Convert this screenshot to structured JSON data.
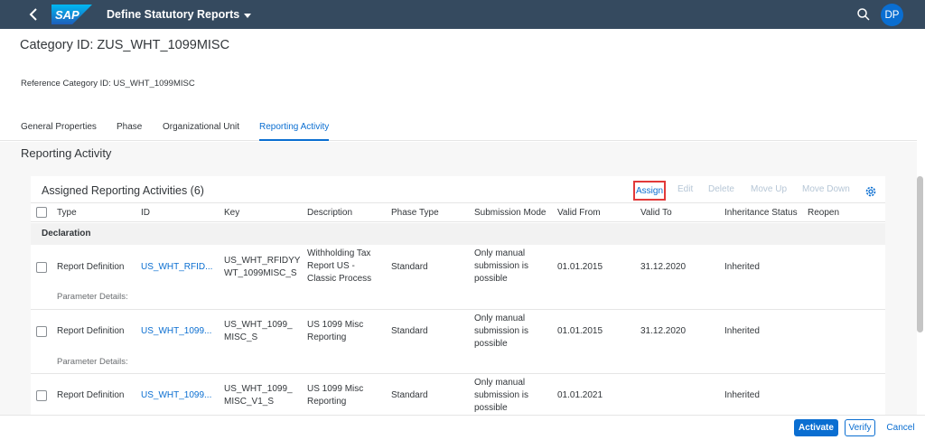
{
  "shell": {
    "app_title": "Define Statutory Reports",
    "logo_text": "SAP",
    "avatar_initials": "DP"
  },
  "header": {
    "object_title": "Category ID: ZUS_WHT_1099MISC",
    "reference_category": "Reference Category ID: US_WHT_1099MISC"
  },
  "tabs": [
    {
      "label": "General Properties"
    },
    {
      "label": "Phase"
    },
    {
      "label": "Organizational Unit"
    },
    {
      "label": "Reporting Activity"
    }
  ],
  "section": {
    "title": "Reporting Activity",
    "table_title": "Assigned Reporting Activities (6)",
    "toolbar": {
      "assign": "Assign",
      "edit": "Edit",
      "delete": "Delete",
      "move_up": "Move Up",
      "move_down": "Move Down"
    },
    "columns": [
      "Type",
      "ID",
      "Key",
      "Description",
      "Phase Type",
      "Submission Mode",
      "Valid From",
      "Valid To",
      "Inheritance Status",
      "Reopen"
    ],
    "group": "Declaration",
    "param_label": "Parameter Details:",
    "rows": [
      {
        "type": "Report Definition",
        "id": "US_WHT_RFID...",
        "key": [
          "US_WHT_RFIDYY",
          "WT_1099MISC_S"
        ],
        "description": [
          "Withholding Tax",
          "Report US -",
          "Classic Process"
        ],
        "phase_type": "Standard",
        "submission": [
          "Only manual",
          "submission is",
          "possible"
        ],
        "valid_from": "01.01.2015",
        "valid_to": "31.12.2020",
        "inheritance": "Inherited"
      },
      {
        "type": "Report Definition",
        "id": "US_WHT_1099...",
        "key": [
          "US_WHT_1099_",
          "MISC_S"
        ],
        "description": [
          "US 1099 Misc",
          "Reporting"
        ],
        "phase_type": "Standard",
        "submission": [
          "Only manual",
          "submission is",
          "possible"
        ],
        "valid_from": "01.01.2015",
        "valid_to": "31.12.2020",
        "inheritance": "Inherited"
      },
      {
        "type": "Report Definition",
        "id": "US_WHT_1099...",
        "key": [
          "US_WHT_1099_",
          "MISC_V1_S"
        ],
        "description": [
          "US 1099 Misc",
          "Reporting"
        ],
        "phase_type": "Standard",
        "submission": [
          "Only manual",
          "submission is",
          "possible"
        ],
        "valid_from": "01.01.2021",
        "valid_to": "",
        "inheritance": "Inherited"
      }
    ]
  },
  "footer": {
    "activate": "Activate",
    "verify": "Verify",
    "cancel": "Cancel"
  },
  "colors": {
    "shell": "#354a5f",
    "accent": "#0a6ed1",
    "highlight": "#e23a3a"
  }
}
